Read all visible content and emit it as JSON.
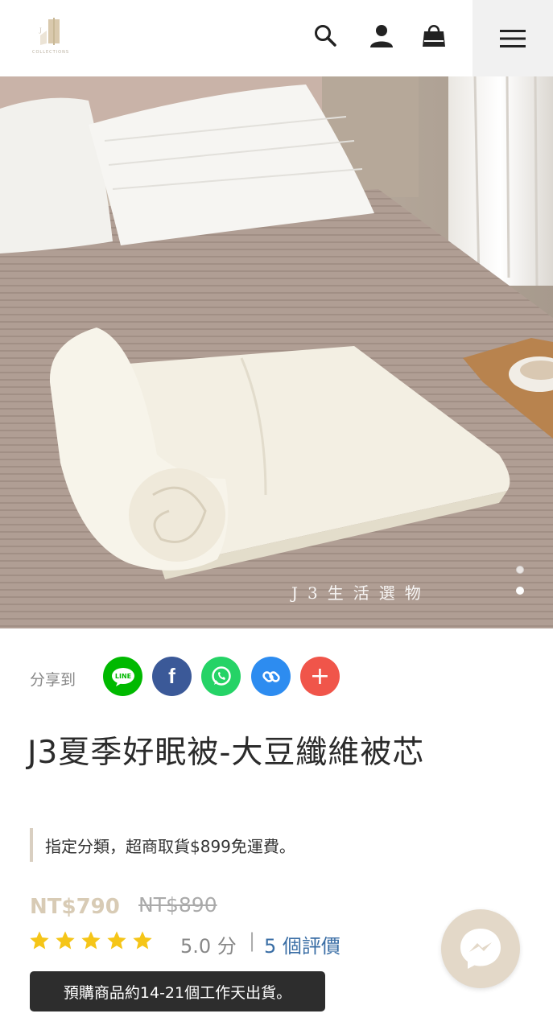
{
  "header": {
    "logo_text": "COLLECTIONS",
    "icons": [
      "search-icon",
      "user-icon",
      "shopping-bag-icon",
      "menu-icon"
    ]
  },
  "hero": {
    "watermark": "J3生活選物",
    "slide_count": 2,
    "active_slide": 1
  },
  "share": {
    "label": "分享到",
    "buttons": [
      {
        "name": "line",
        "label": "LINE",
        "color": "#00b900"
      },
      {
        "name": "facebook",
        "label": "f",
        "color": "#3b5998"
      },
      {
        "name": "whatsapp",
        "label": "",
        "color": "#25d366"
      },
      {
        "name": "copy-link",
        "label": "",
        "color": "#2d8cf0"
      },
      {
        "name": "more",
        "label": "+",
        "color": "#f0554a"
      }
    ]
  },
  "product": {
    "title": "J3夏季好眠被-大豆纖維被芯",
    "promo": "指定分類，超商取貨$899免運費。",
    "price": "NT$790",
    "original_price": "NT$890",
    "rating_score": "5.0 分",
    "rating_separator": "|",
    "rating_count": "5 個評價",
    "stars": 5,
    "notice": "預購商品約14-21個工作天出貨。"
  },
  "colors": {
    "accent": "#d8cbb5",
    "star": "#f5c518",
    "link": "#3a6ea5"
  }
}
